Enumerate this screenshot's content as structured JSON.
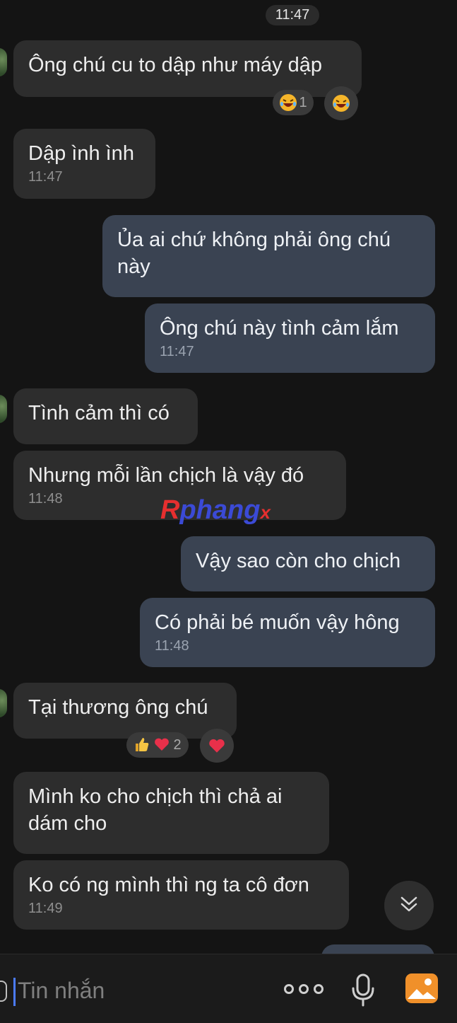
{
  "header": {
    "time": "11:47"
  },
  "messages": [
    {
      "side": "in",
      "text": "Ông chú cu to dập như máy dập",
      "time": ""
    },
    {
      "side": "in",
      "text": "Dập ình ình",
      "time": "11:47"
    },
    {
      "side": "out",
      "text": "Ủa ai chứ không phải ông chú này",
      "time": ""
    },
    {
      "side": "out",
      "text": "Ông chú này tình cảm lắm",
      "time": "11:47"
    },
    {
      "side": "in",
      "text": "Tình cảm thì có",
      "time": ""
    },
    {
      "side": "in",
      "text": "Nhưng mỗi lần chịch là vậy đó",
      "time": "11:48"
    },
    {
      "side": "out",
      "text": "Vậy sao còn cho chịch",
      "time": ""
    },
    {
      "side": "out",
      "text": "Có phải bé muốn vậy hông",
      "time": "11:48"
    },
    {
      "side": "in",
      "text": "Tại thương ông chú",
      "time": ""
    },
    {
      "side": "in",
      "text": "Mình ko cho chịch thì chả ai dám cho",
      "time": ""
    },
    {
      "side": "in",
      "text": "Ko có ng mình thì ng ta cô đơn",
      "time": "11:49"
    }
  ],
  "reactions": {
    "first": {
      "emojis": [
        "laughing-face"
      ],
      "count": "1",
      "quick": "laughing-face"
    },
    "second": {
      "emojis": [
        "thumbs-up",
        "heart"
      ],
      "count": "2",
      "quick": "heart"
    }
  },
  "watermark": {
    "part1": "R",
    "part2": "phang",
    "part3": "x"
  },
  "input": {
    "placeholder": "Tin nhắn"
  },
  "colors": {
    "background": "#141414",
    "incoming": "#2d2d2d",
    "outgoing": "#3a4352",
    "accent": "#f0902a"
  }
}
